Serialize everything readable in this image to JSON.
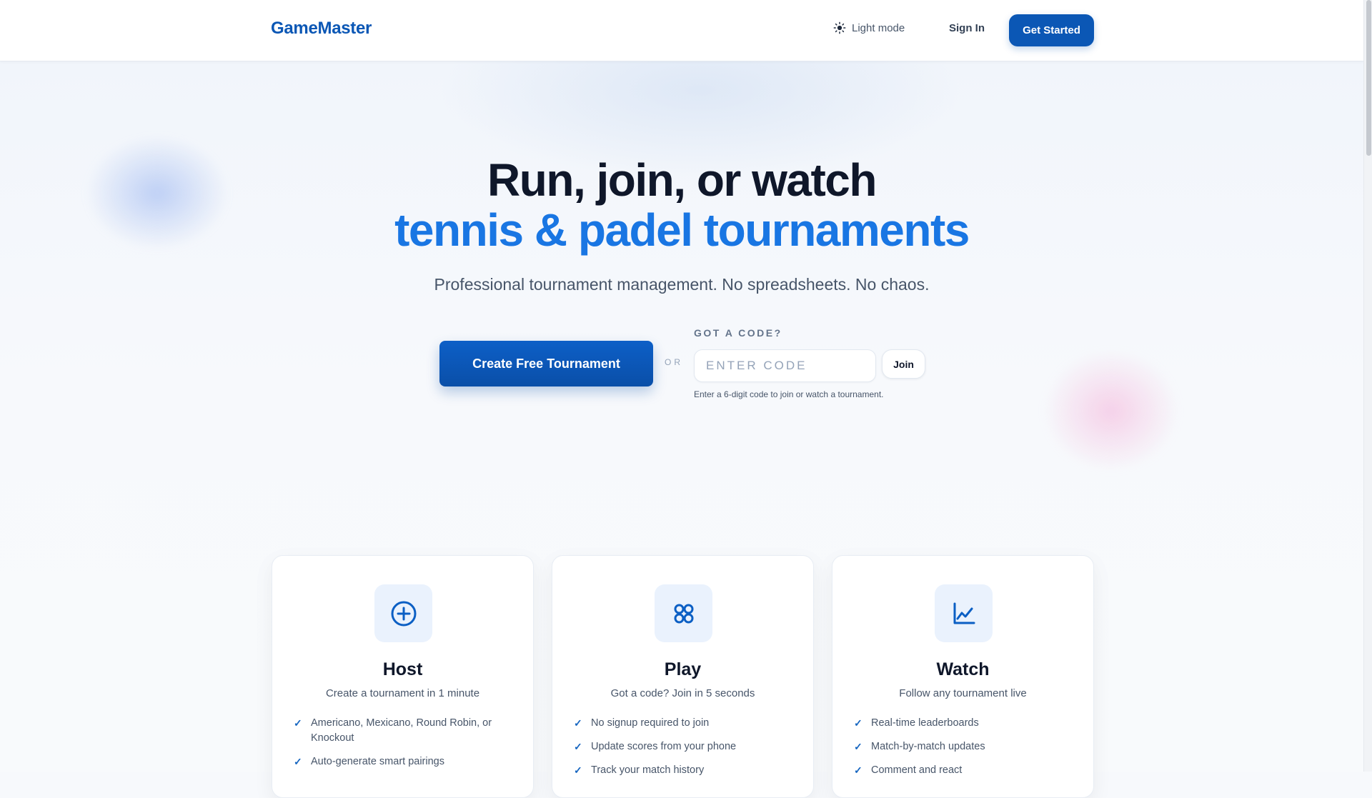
{
  "header": {
    "brand": "GameMaster",
    "theme_toggle": "Light mode",
    "sign_in": "Sign In",
    "get_started": "Get Started"
  },
  "hero": {
    "title_line1": "Run, join, or watch",
    "title_line2": "tennis & padel tournaments",
    "subtitle": "Professional tournament management. No spreadsheets. No chaos.",
    "create_button": "Create Free Tournament",
    "or_label": "OR",
    "code_label": "GOT A CODE?",
    "code_placeholder": "ENTER CODE",
    "code_value": "",
    "join_button": "Join",
    "code_hint": "Enter a 6-digit code to join or watch a tournament."
  },
  "features": [
    {
      "icon": "plus-circle-icon",
      "title": "Host",
      "subtitle": "Create a tournament in 1 minute",
      "items": [
        "Americano, Mexicano, Round Robin, or Knockout",
        "Auto-generate smart pairings"
      ]
    },
    {
      "icon": "apps-grid-icon",
      "title": "Play",
      "subtitle": "Got a code? Join in 5 seconds",
      "items": [
        "No signup required to join",
        "Update scores from your phone",
        "Track your match history"
      ]
    },
    {
      "icon": "chart-line-icon",
      "title": "Watch",
      "subtitle": "Follow any tournament live",
      "items": [
        "Real-time leaderboards",
        "Match-by-match updates",
        "Comment and react"
      ]
    }
  ],
  "colors": {
    "brand": "#0b57b5",
    "accent_text": "#1976e3",
    "icon_tile": "#eaf2fd"
  }
}
